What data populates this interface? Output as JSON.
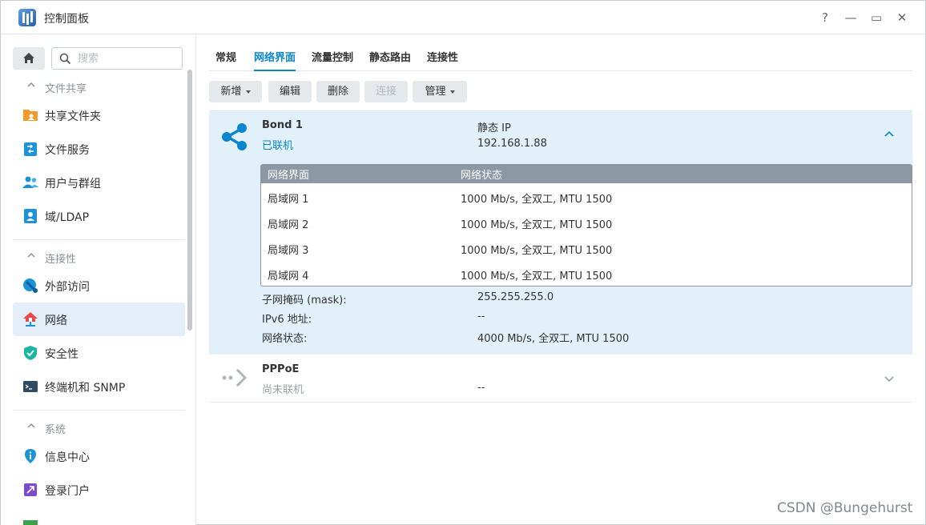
{
  "window": {
    "title": "控制面板",
    "controls": {
      "help": "?",
      "minimize": "—",
      "maximize": "▭",
      "close": "✕"
    }
  },
  "sidebar": {
    "search_placeholder": "搜索",
    "sections": [
      {
        "label": "文件共享",
        "items": [
          {
            "label": "共享文件夹",
            "icon": "folder-share-icon"
          },
          {
            "label": "文件服务",
            "icon": "file-services-icon"
          },
          {
            "label": "用户与群组",
            "icon": "users-group-icon"
          },
          {
            "label": "域/LDAP",
            "icon": "domain-ldap-icon"
          }
        ]
      },
      {
        "label": "连接性",
        "items": [
          {
            "label": "外部访问",
            "icon": "external-access-icon"
          },
          {
            "label": "网络",
            "icon": "network-house-icon",
            "active": true
          },
          {
            "label": "安全性",
            "icon": "security-shield-icon"
          },
          {
            "label": "终端机和 SNMP",
            "icon": "terminal-icon"
          }
        ]
      },
      {
        "label": "系统",
        "items": [
          {
            "label": "信息中心",
            "icon": "info-center-icon"
          },
          {
            "label": "登录门户",
            "icon": "login-portal-icon"
          }
        ]
      }
    ]
  },
  "tabs": [
    "常规",
    "网络界面",
    "流量控制",
    "静态路由",
    "连接性"
  ],
  "active_tab": "网络界面",
  "toolbar": {
    "create": "新增",
    "edit": "编辑",
    "delete": "删除",
    "connect": "连接",
    "manage": "管理"
  },
  "bond": {
    "name": "Bond 1",
    "status": "已联机",
    "ip_mode": "静态 IP",
    "ip": "192.168.1.88",
    "table_headers": [
      "网络界面",
      "网络状态"
    ],
    "members": [
      {
        "name": "局域网 1",
        "state": "1000 Mb/s, 全双工, MTU 1500"
      },
      {
        "name": "局域网 2",
        "state": "1000 Mb/s, 全双工, MTU 1500"
      },
      {
        "name": "局域网 3",
        "state": "1000 Mb/s, 全双工, MTU 1500"
      },
      {
        "name": "局域网 4",
        "state": "1000 Mb/s, 全双工, MTU 1500"
      }
    ],
    "mask_label": "子网掩码 (mask):",
    "mask_value": "255.255.255.0",
    "ipv6_label": "IPv6 地址:",
    "ipv6_value": "--",
    "netstate_label": "网络状态:",
    "netstate_value": "4000 Mb/s, 全双工, MTU 1500"
  },
  "pppoe": {
    "name": "PPPoE",
    "status": "尚未联机",
    "value": "--"
  },
  "watermark": "CSDN @Bungehurst",
  "colors": {
    "accent": "#0a86d0",
    "panel_bg": "#e2f0fa",
    "table_head": "#8c98a3"
  }
}
